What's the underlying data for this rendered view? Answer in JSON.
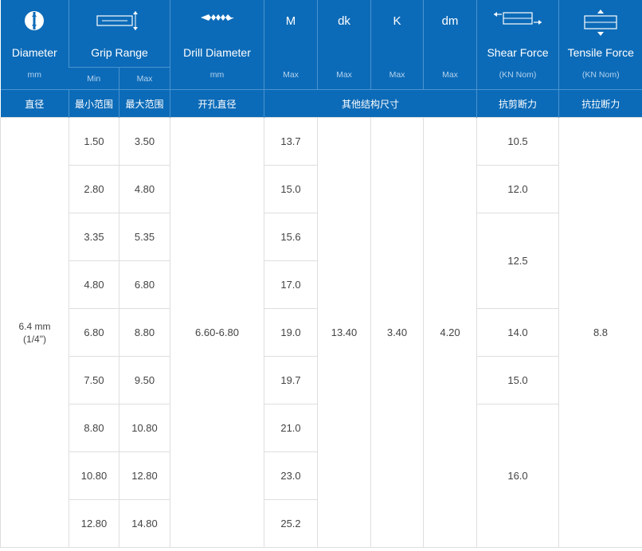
{
  "headers": {
    "diameter": {
      "title": "Diameter",
      "unit": "mm",
      "cn": "直径"
    },
    "grip_range": {
      "title": "Grip Range",
      "min": "Min",
      "max": "Max",
      "cn_min": "最小范围",
      "cn_max": "最大范围"
    },
    "drill_diameter": {
      "title": "Drill Diameter",
      "unit": "mm",
      "cn": "开孔直径"
    },
    "m": {
      "symbol": "M",
      "unit": "Max"
    },
    "dk": {
      "symbol": "dk",
      "unit": "Max"
    },
    "k": {
      "symbol": "K",
      "unit": "Max"
    },
    "dm": {
      "symbol": "dm",
      "unit": "Max"
    },
    "other_cn": "其他结构尺寸",
    "shear": {
      "title": "Shear Force",
      "unit": "(KN Nom)",
      "cn": "抗剪断力"
    },
    "tensile": {
      "title": "Tensile Force",
      "unit": "(KN Nom)",
      "cn": "抗拉断力"
    }
  },
  "diameter": {
    "line1": "6.4 mm",
    "line2": "(1/4\")"
  },
  "drill": "6.60-6.80",
  "dk": "13.40",
  "k": "3.40",
  "dm": "4.20",
  "tensile": "8.8",
  "grip_min": [
    "1.50",
    "2.80",
    "3.35",
    "4.80",
    "6.80",
    "7.50",
    "8.80",
    "10.80",
    "12.80"
  ],
  "grip_max": [
    "3.50",
    "4.80",
    "5.35",
    "6.80",
    "8.80",
    "9.50",
    "10.80",
    "12.80",
    "14.80"
  ],
  "m_values": [
    "13.7",
    "15.0",
    "15.6",
    "17.0",
    "19.0",
    "19.7",
    "21.0",
    "23.0",
    "25.2"
  ],
  "shear_values": [
    "10.5",
    "12.0",
    "12.5",
    "14.0",
    "15.0",
    "16.0"
  ],
  "colors": {
    "header_bg": "#0c6bb8",
    "border": "#dedede"
  }
}
